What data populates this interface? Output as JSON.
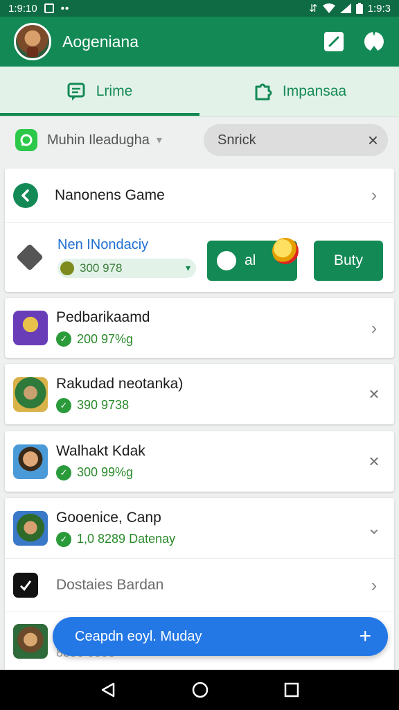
{
  "status_bar": {
    "time": "1:9:10",
    "right_text": "1:9:3"
  },
  "app_bar": {
    "title": "Aogeniana",
    "edit_icon": "edit-icon",
    "profile_icon": "profile-icon"
  },
  "tabs": [
    {
      "label": "Lrime",
      "icon": "chat-icon",
      "active": true
    },
    {
      "label": "Impansaa",
      "icon": "puzzle-icon",
      "active": false
    }
  ],
  "filter": {
    "label": "Muhin Ileadugha",
    "search_value": "Snrick"
  },
  "top_card": {
    "title": "Nanonens Game",
    "featured_name": "Nen INondaciy",
    "featured_price": "300 978",
    "chat_label": "al",
    "buy_label": "Buty"
  },
  "games": [
    {
      "name": "Pedbarikaamd",
      "price": "200 97%g",
      "action": "chevron"
    },
    {
      "name": "Rakudad neotanka)",
      "price": "390 9738",
      "action": "close"
    },
    {
      "name": "Walhakt Kdak",
      "price": "300 99%g",
      "action": "close"
    }
  ],
  "bottom_card": {
    "item1_name": "Gooenice, Canp",
    "item1_price": "1,0 8289 Datenay",
    "item2_name": "Dostaies Bardan",
    "item3_price": "8890 0098"
  },
  "fab": {
    "label": "Ceapdn eoyl. Muday"
  },
  "colors": {
    "primary": "#138a55",
    "status_bar": "#0e6b44",
    "fab": "#2478e6",
    "link": "#1f6fd0"
  }
}
